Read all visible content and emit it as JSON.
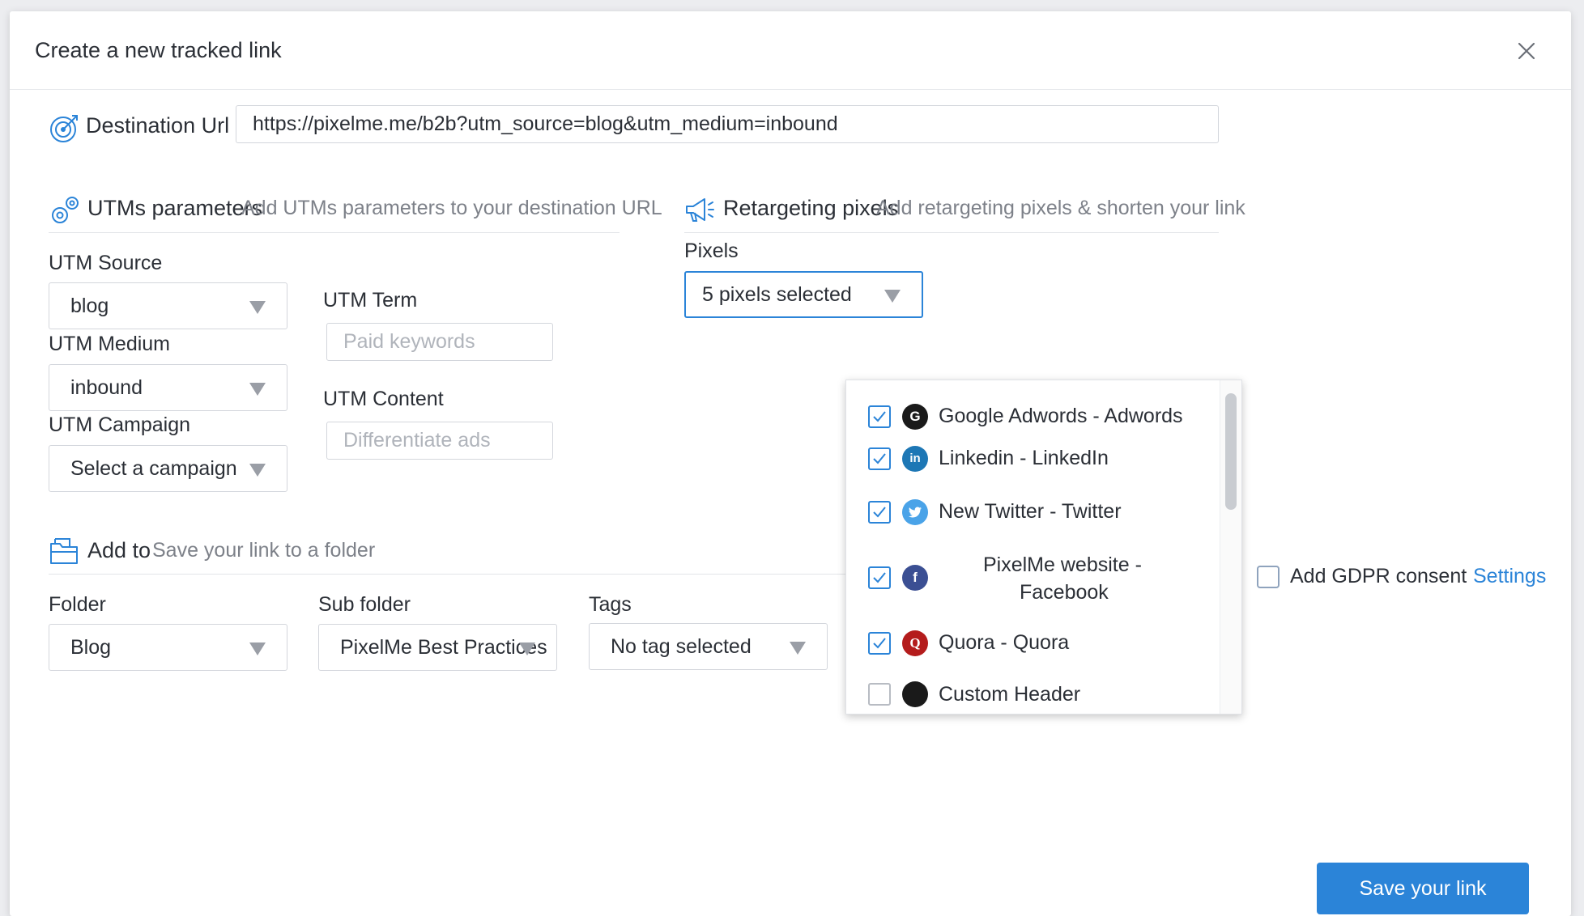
{
  "modal": {
    "title": "Create a new tracked link"
  },
  "destination": {
    "label": "Destination Url",
    "value": "https://pixelme.me/b2b?utm_source=blog&utm_medium=inbound"
  },
  "utm": {
    "title": "UTMs parameters",
    "subtitle": "Add UTMs parameters to your destination URL",
    "source_label": "UTM Source",
    "source_value": "blog",
    "medium_label": "UTM Medium",
    "medium_value": "inbound",
    "campaign_label": "UTM Campaign",
    "campaign_value": "Select a campaign",
    "term_label": "UTM Term",
    "term_placeholder": "Paid keywords",
    "content_label": "UTM Content",
    "content_placeholder": "Differentiate ads"
  },
  "retargeting": {
    "title": "Retargeting pixels",
    "subtitle": "Add retargeting pixels & shorten your link",
    "pixels_label": "Pixels",
    "pixels_value": "5 pixels selected",
    "items": [
      {
        "label": "Google Adwords - Adwords",
        "checked": true,
        "icon": "google-icon",
        "icon_char": "G",
        "color": "#1a1a1a"
      },
      {
        "label": "Linkedin - LinkedIn",
        "checked": true,
        "icon": "linkedin-icon",
        "icon_char": "in",
        "color": "#1d77b5"
      },
      {
        "label": "New Twitter - Twitter",
        "checked": true,
        "icon": "twitter-icon",
        "icon_char": "",
        "color": "#4aa3e8"
      },
      {
        "label_line1": "PixelMe website -",
        "label_line2": "Facebook",
        "checked": true,
        "icon": "facebook-icon",
        "icon_char": "f",
        "color": "#3b4f93"
      },
      {
        "label": "Quora - Quora",
        "checked": true,
        "icon": "quora-icon",
        "icon_char": "Q",
        "color": "#b41c1c"
      },
      {
        "label": "Custom Header",
        "checked": false,
        "icon": "custom-header-icon",
        "icon_char": "",
        "color": "#1a1a1a"
      }
    ],
    "gdpr_label": "Add GDPR consent",
    "settings_link": "Settings"
  },
  "add_to": {
    "title": "Add to",
    "subtitle": "Save your link to a folder",
    "folder_label": "Folder",
    "folder_value": "Blog",
    "subfolder_label": "Sub folder",
    "subfolder_value": "PixelMe Best Practices",
    "tags_label": "Tags",
    "tags_value": "No tag selected"
  },
  "actions": {
    "save_label": "Save your link"
  },
  "colors": {
    "accent": "#2b84d8",
    "text": "#2b2f36",
    "muted": "#7d8189"
  }
}
